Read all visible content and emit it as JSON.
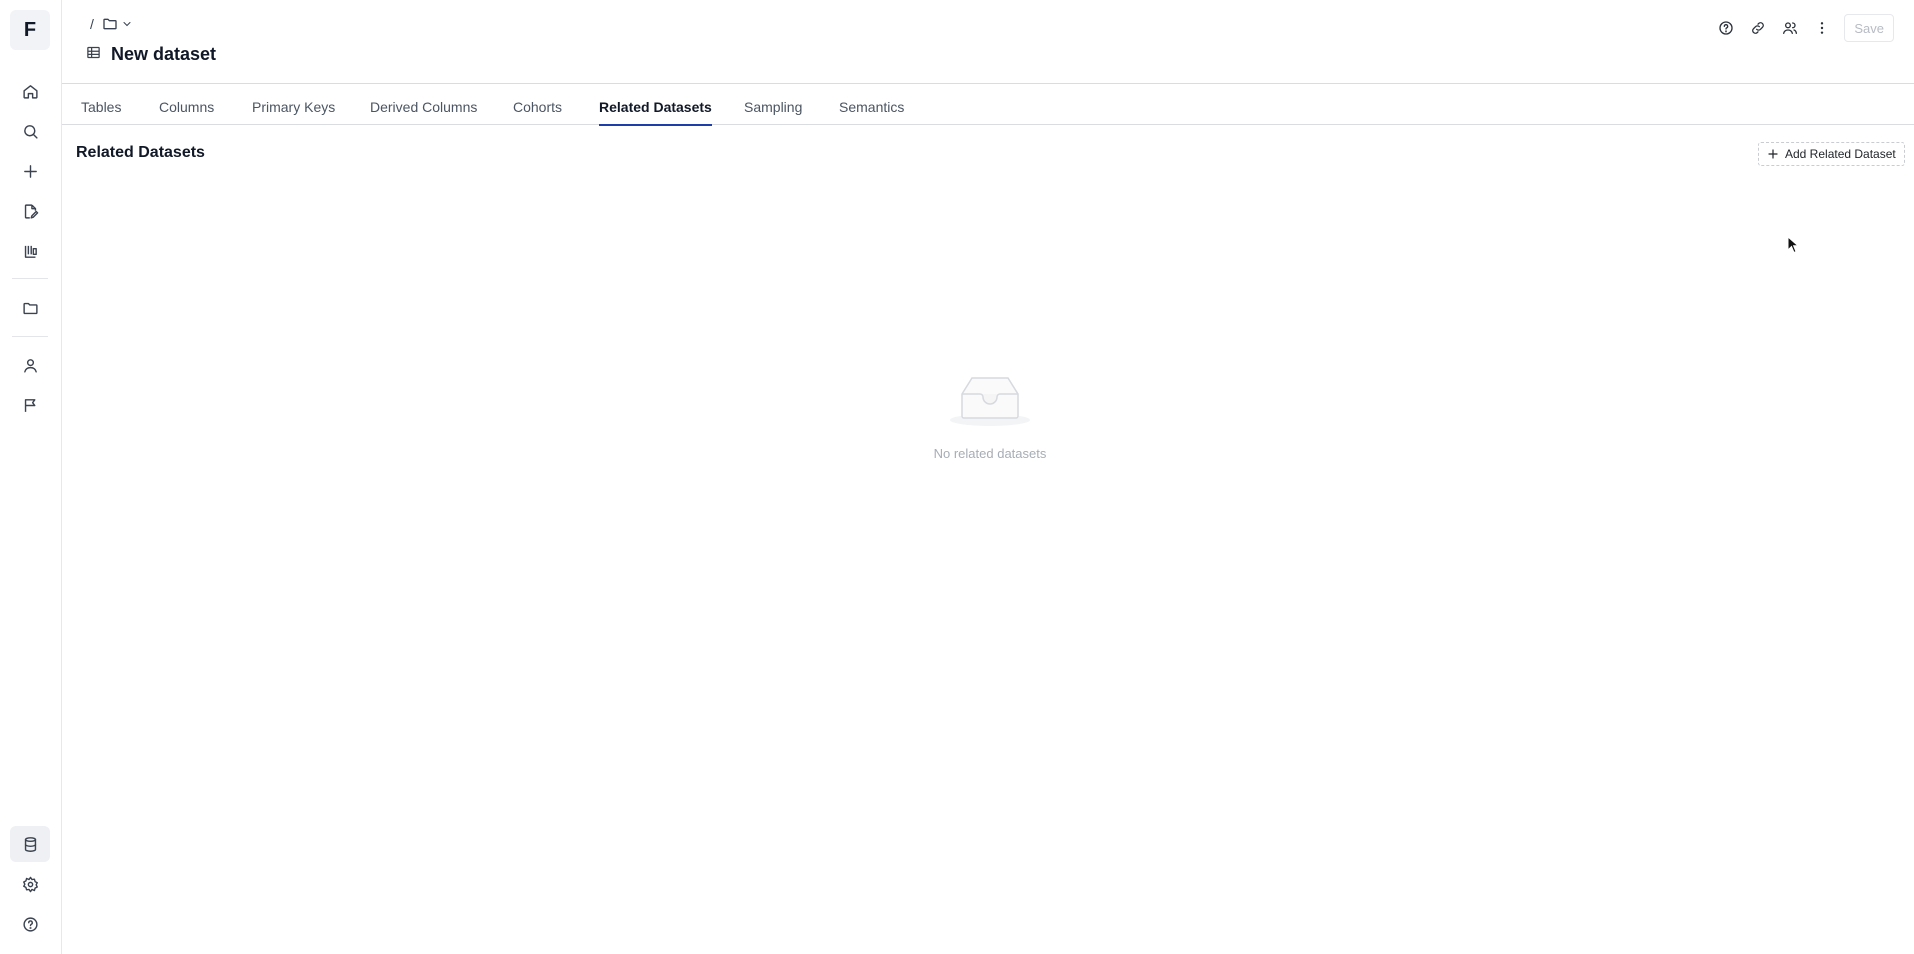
{
  "rail": {
    "logo_letter": "F",
    "top_items": [
      {
        "icon": "home-icon"
      },
      {
        "icon": "search-icon"
      },
      {
        "icon": "plus-icon"
      },
      {
        "icon": "edit-document-icon"
      },
      {
        "icon": "lab-icon"
      },
      {
        "icon": "folder-icon"
      },
      {
        "icon": "user-icon"
      },
      {
        "icon": "flag-icon"
      }
    ],
    "bottom_items": [
      {
        "icon": "database-icon",
        "active": true
      },
      {
        "icon": "gear-icon"
      },
      {
        "icon": "help-icon"
      }
    ]
  },
  "header": {
    "breadcrumb_separator": "/",
    "title": "New dataset",
    "actions": [
      {
        "icon": "help-circle-icon"
      },
      {
        "icon": "link-icon"
      },
      {
        "icon": "users-icon"
      },
      {
        "icon": "more-vertical-icon"
      }
    ],
    "save_label": "Save"
  },
  "tabs": {
    "items": [
      "Tables",
      "Columns",
      "Primary Keys",
      "Derived Columns",
      "Cohorts",
      "Related Datasets",
      "Sampling",
      "Semantics"
    ],
    "active": "Related Datasets"
  },
  "section": {
    "title": "Related Datasets",
    "add_button_label": "Add Related Dataset"
  },
  "empty_state": {
    "icon": "inbox-icon",
    "text": "No related datasets"
  },
  "colors": {
    "accent": "#1d3fa8",
    "muted_text": "#a7adb6",
    "border": "#d9dce1"
  }
}
